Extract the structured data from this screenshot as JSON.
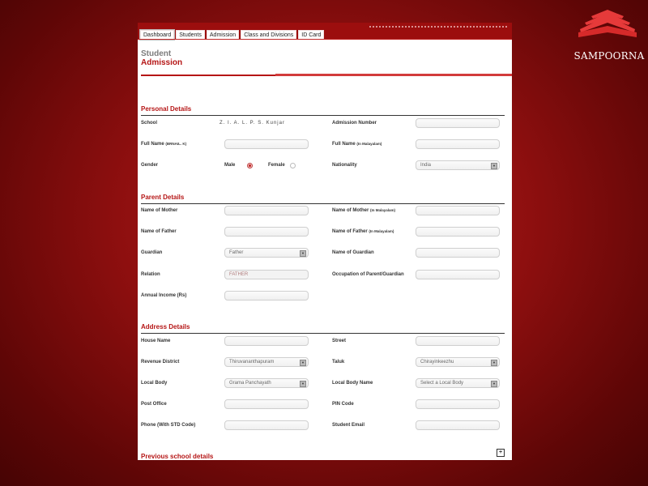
{
  "brand": {
    "name": "SAMPOORNA"
  },
  "nav": {
    "tabs": [
      "Dashboard",
      "Students",
      "Admission",
      "Class and Divisions",
      "ID Card"
    ]
  },
  "page": {
    "title_line1": "Student",
    "title_line2": "Admission"
  },
  "sections": {
    "personal": "Personal Details",
    "parent": "Parent Details",
    "address": "Address Details",
    "previous": "Previous school details"
  },
  "personal": {
    "school_label": "School",
    "school_value": "Z. I. A. L. P. S. Kunjar",
    "admission_label": "Admission Number",
    "fullname_label": "Full Name",
    "fullname_hint": "(BRNAIL. K)",
    "fullname_ml_label": "Full Name",
    "fullname_ml_hint": "(In Malayalam)",
    "gender_label": "Gender",
    "male": "Male",
    "female": "Female",
    "nationality_label": "Nationality",
    "nationality_value": "India"
  },
  "parent": {
    "mother_label": "Name of Mother",
    "mother_ml_label": "Name of Mother",
    "mother_ml_hint": "(In Malayalam)",
    "father_label": "Name of Father",
    "father_ml_label": "Name of Father",
    "father_ml_hint": "(In Malayalam)",
    "guardian_label": "Guardian",
    "guardian_value": "Father",
    "guardian_name_label": "Name of Guardian",
    "relation_label": "Relation",
    "relation_value": "FATHER",
    "occupation_label": "Occupation of Parent/Guardian",
    "income_label": "Annual Income (Rs)"
  },
  "address": {
    "house_label": "House Name",
    "street_label": "Street",
    "district_label": "Revenue District",
    "district_value": "Thiruvananthapuram",
    "taluk_label": "Taluk",
    "taluk_value": "Chirayinkeezhu",
    "localbody_label": "Local Body",
    "localbody_value": "Grama Panchayath",
    "localbody_name_label": "Local Body Name",
    "localbody_name_value": "Select a Local Body",
    "postoffice_label": "Post Office",
    "pin_label": "PIN Code",
    "phone_label": "Phone (With STD Code)",
    "email_label": "Student Email"
  },
  "previous": {
    "expand_symbol": "+"
  }
}
